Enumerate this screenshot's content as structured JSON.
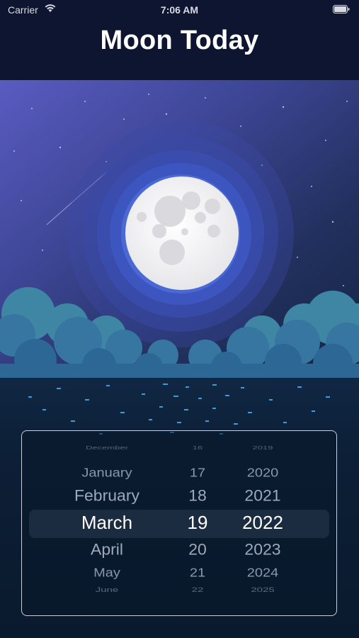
{
  "status_bar": {
    "carrier": "Carrier",
    "time": "7:06 AM",
    "wifi_icon": "wifi-icon",
    "battery_icon": "battery-icon"
  },
  "header": {
    "title": "Moon Today"
  },
  "scene": {
    "moon_icon": "full-moon-illustration",
    "sky_color": "#5a5bc0",
    "moon_color": "#f2f2f2"
  },
  "date_picker": {
    "months": [
      "December",
      "January",
      "February",
      "March",
      "April",
      "May",
      "June"
    ],
    "days": [
      "16",
      "17",
      "18",
      "19",
      "20",
      "21",
      "22"
    ],
    "years": [
      "2019",
      "2020",
      "2021",
      "2022",
      "2023",
      "2024",
      "2025"
    ],
    "selected": {
      "month": "March",
      "day": "19",
      "year": "2022"
    }
  }
}
